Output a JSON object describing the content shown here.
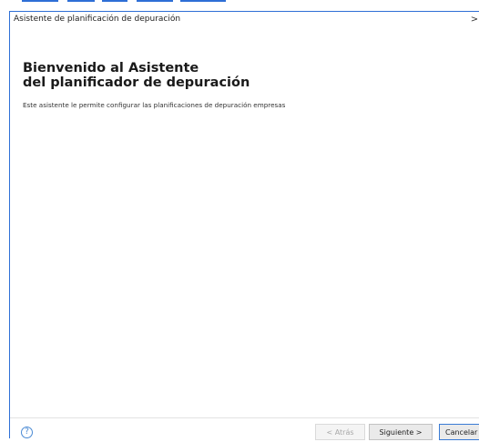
{
  "window": {
    "title": "Asistente de planificación de depuración",
    "close_glyph": ">"
  },
  "welcome": {
    "heading_line1": "Bienvenido al Asistente",
    "heading_line2": "del planificador de depuración",
    "description": "Este asistente le permite configurar las planificaciones de depuración empresas"
  },
  "footer": {
    "help_glyph": "?",
    "back_label": "< Atrás",
    "next_label": "Siguiente >",
    "cancel_label": "Cancelar"
  },
  "colors": {
    "accent": "#2e6fd6",
    "focus_border": "#3a7bd5",
    "disabled_text": "#a8a8a8"
  }
}
